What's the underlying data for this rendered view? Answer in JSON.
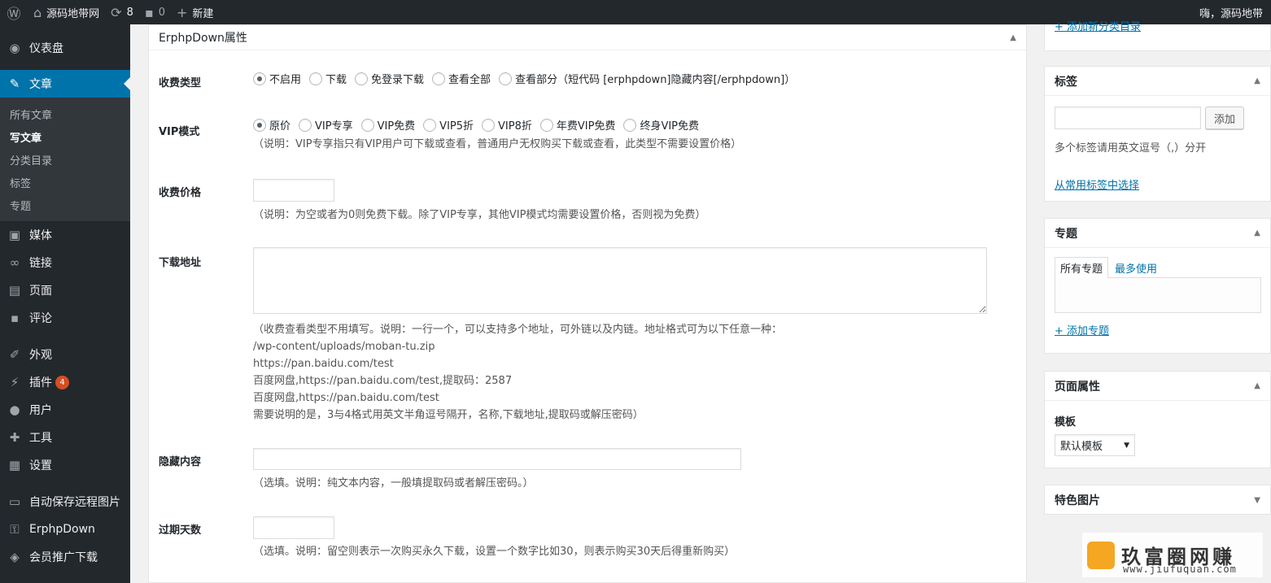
{
  "adminbar": {
    "site_name": "源码地带网",
    "updates_count": "8",
    "comments_count": "0",
    "new_label": "新建",
    "greeting": "嗨，源码地带"
  },
  "menu": {
    "dashboard": "仪表盘",
    "posts": "文章",
    "posts_sub": [
      "所有文章",
      "写文章",
      "分类目录",
      "标签",
      "专题"
    ],
    "media": "媒体",
    "links": "链接",
    "pages": "页面",
    "comments": "评论",
    "appearance": "外观",
    "plugins": "插件",
    "plugins_badge": "4",
    "users": "用户",
    "tools": "工具",
    "settings": "设置",
    "auto_save": "自动保存远程图片",
    "erphpdown": "ErphpDown",
    "affiliate": "会员推广下载"
  },
  "erphp": {
    "title": "ErphpDown属性",
    "fee_type_label": "收费类型",
    "fee_type_options": [
      "不启用",
      "下载",
      "免登录下载",
      "查看全部",
      "查看部分（短代码 [erphpdown]隐藏内容[/erphpdown]）"
    ],
    "vip_label": "VIP模式",
    "vip_options": [
      "原价",
      "VIP专享",
      "VIP免费",
      "VIP5折",
      "VIP8折",
      "年费VIP免费",
      "终身VIP免费"
    ],
    "vip_desc": "（说明：VIP专享指只有VIP用户可下载或查看，普通用户无权购买下载或查看，此类型不需要设置价格）",
    "price_label": "收费价格",
    "price_desc": "（说明：为空或者为0则免费下载。除了VIP专享，其他VIP模式均需要设置价格，否则视为免费）",
    "url_label": "下载地址",
    "url_desc_lines": [
      "（收费查看类型不用填写。说明：一行一个，可以支持多个地址，可外链以及内链。地址格式可为以下任意一种：",
      "/wp-content/uploads/moban-tu.zip",
      "https://pan.baidu.com/test",
      "百度网盘,https://pan.baidu.com/test,提取码：2587",
      "百度网盘,https://pan.baidu.com/test",
      "需要说明的是，3与4格式用英文半角逗号隔开，名称,下载地址,提取码或解压密码）"
    ],
    "hidden_label": "隐藏内容",
    "hidden_desc": "（选填。说明：纯文本内容，一般填提取码或者解压密码。）",
    "days_label": "过期天数",
    "days_desc": "（选填。说明：留空则表示一次购买永久下载，设置一个数字比如30，则表示购买30天后得重新购买）"
  },
  "sidebar_right": {
    "add_category_link": "+ 添加新分类目录",
    "tags_title": "标签",
    "tags_add_button": "添加",
    "tags_hint": "多个标签请用英文逗号（,）分开",
    "tags_choose_link": "从常用标签中选择",
    "topics_title": "专题",
    "topics_tab_all": "所有专题",
    "topics_tab_most": "最多使用",
    "topics_add_link": "+ 添加专题",
    "page_attr_title": "页面属性",
    "template_label": "模板",
    "template_value": "默认模板",
    "featured_title": "特色图片"
  },
  "watermark": {
    "text": "玖富圈网赚",
    "url": "www.jiufuquan.com"
  }
}
